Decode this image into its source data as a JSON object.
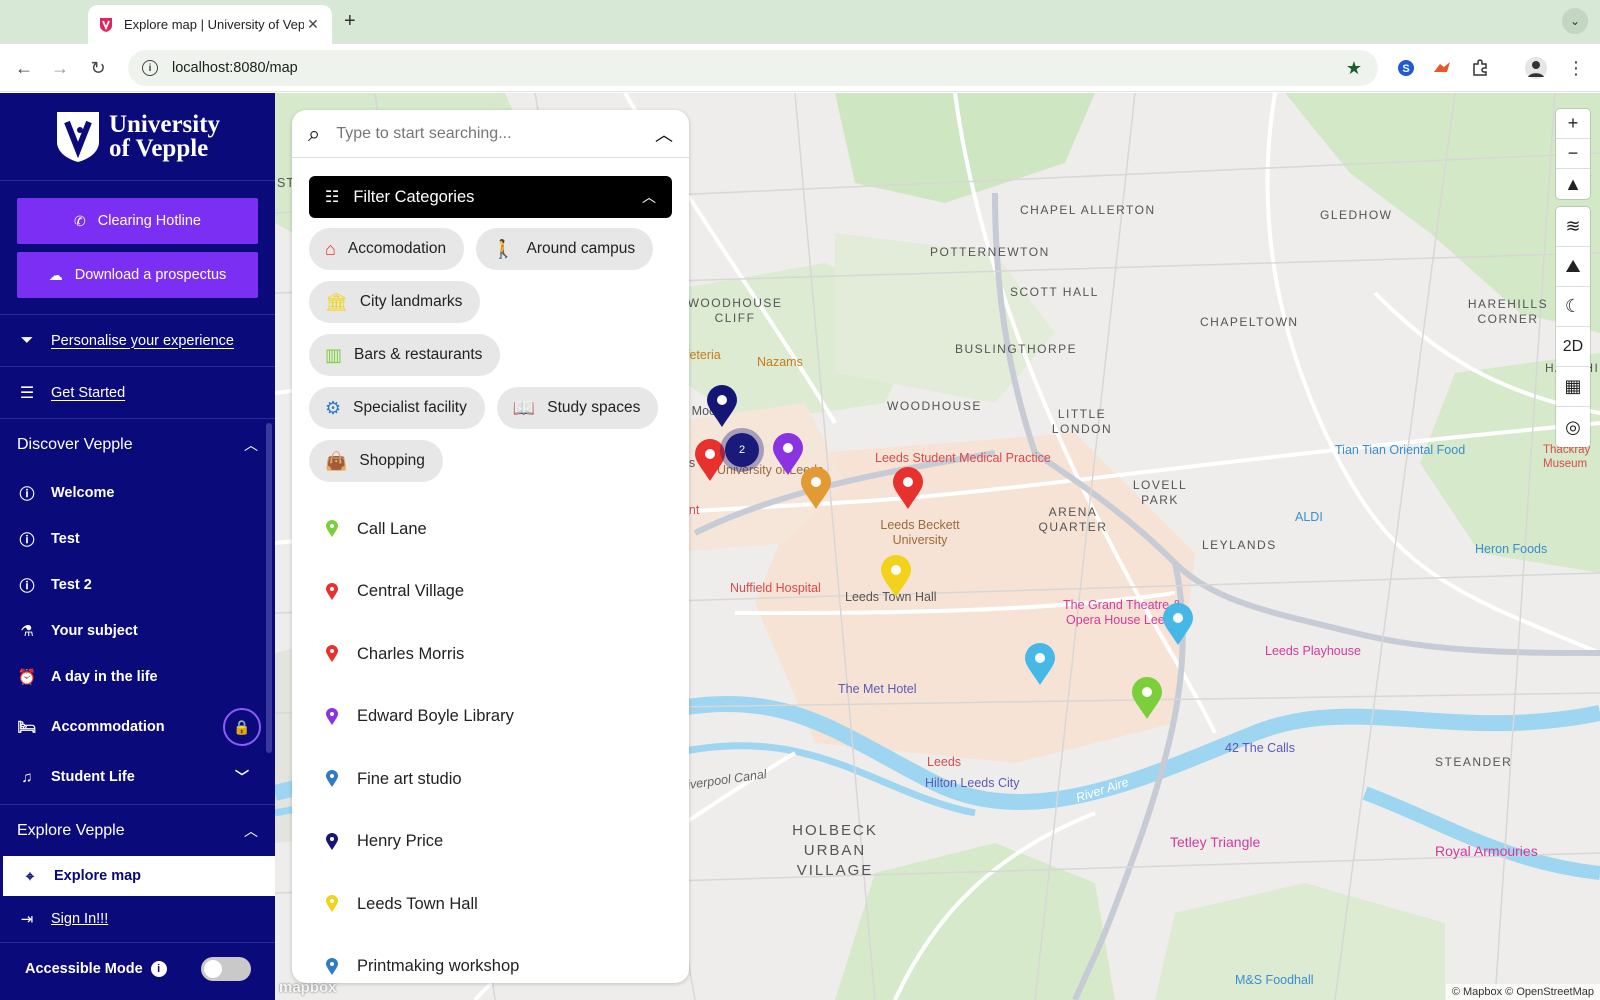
{
  "browser": {
    "tab_title": "Explore map | University of Vepple",
    "url": "localhost:8080/map"
  },
  "sidebar": {
    "logo_line1": "University",
    "logo_line2": "of Vepple",
    "clearing_label": "Clearing Hotline",
    "prospectus_label": "Download a prospectus",
    "personalise_label": "Personalise your experience",
    "get_started_label": "Get Started",
    "discover": {
      "heading": "Discover Vepple",
      "items": [
        {
          "label": "Welcome",
          "icon": "info-icon"
        },
        {
          "label": "Test",
          "icon": "info-icon"
        },
        {
          "label": "Test 2",
          "icon": "info-icon"
        },
        {
          "label": "Your subject",
          "icon": "subject-icon"
        },
        {
          "label": "A day in the life",
          "icon": "alarm-icon"
        },
        {
          "label": "Accommodation",
          "icon": "bed-icon"
        },
        {
          "label": "Student Life",
          "icon": "music-icon"
        }
      ]
    },
    "explore": {
      "heading": "Explore Vepple",
      "active_item": "Explore map"
    },
    "sign_in_label": "Sign In!!!",
    "accessible_label": "Accessible Mode"
  },
  "search": {
    "placeholder": "Type to start searching..."
  },
  "filter": {
    "heading": "Filter Categories",
    "categories": [
      {
        "label": "Accomodation",
        "icon": "house-icon",
        "color": "#e8302c"
      },
      {
        "label": "Around campus",
        "icon": "walker-icon",
        "color": "#f0a030"
      },
      {
        "label": "City landmarks",
        "icon": "landmark-icon",
        "color": "#f2d21b"
      },
      {
        "label": "Bars & restaurants",
        "icon": "pint-icon",
        "color": "#7bcf3a"
      },
      {
        "label": "Specialist facility",
        "icon": "cog-icon",
        "color": "#2f7ac9"
      },
      {
        "label": "Study spaces",
        "icon": "book-icon",
        "color": "#8a33e0"
      },
      {
        "label": "Shopping",
        "icon": "bag-icon",
        "color": "#45b8e8"
      }
    ]
  },
  "locations": [
    {
      "label": "Call Lane",
      "color": "#7bcf3a"
    },
    {
      "label": "Central Village",
      "color": "#e8302c"
    },
    {
      "label": "Charles Morris",
      "color": "#e8302c"
    },
    {
      "label": "Edward Boyle Library",
      "color": "#8a33e0"
    },
    {
      "label": "Fine art studio",
      "color": "#2f7ac9"
    },
    {
      "label": "Henry Price",
      "color": "#151575"
    },
    {
      "label": "Leeds Town Hall",
      "color": "#f2d21b"
    },
    {
      "label": "Printmaking workshop",
      "color": "#2f7ac9"
    }
  ],
  "map": {
    "areas": [
      "CHAPEL ALLERTON",
      "GLEDHOW",
      "POTTERNEWTON",
      "SCOTT HALL",
      "CHAPELTOWN",
      "HAREHILLS CORNER",
      "HAREHILLS",
      "WOODHOUSE CLIFF",
      "BUSLINGTHORPE",
      "WOODHOUSE",
      "LITTLE LONDON",
      "LOVELL PARK",
      "ARENA QUARTER",
      "LEYLANDS",
      "STEANDER",
      "HOLBECK URBAN VILLAGE"
    ],
    "pois": [
      "Cafeteria",
      "Nazams",
      "Leeds Student Medical Practice",
      "University of Leeds",
      "Leeds Beckett University",
      "Nuffield Hospital",
      "Leeds Town Hall",
      "The Grand Theatre & Opera House Leeds",
      "Leeds Playhouse",
      "The Met Hotel",
      "Leeds",
      "Hilton Leeds City",
      "42 The Calls",
      "Tetley Triangle",
      "Royal Armouries",
      "Tian Tian Oriental Food",
      "ALDI",
      "Heron Foods",
      "Thackray Museum",
      "River Aire",
      "Liverpool Canal",
      "M&S Foodhall",
      "se Moo",
      "eds",
      "ount",
      "ST"
    ],
    "cluster_count": "2",
    "zoom_in": "+",
    "zoom_out": "−",
    "view_mode": "2D",
    "logo": "mapbox",
    "attribution": "© Mapbox © OpenStreetMap"
  }
}
